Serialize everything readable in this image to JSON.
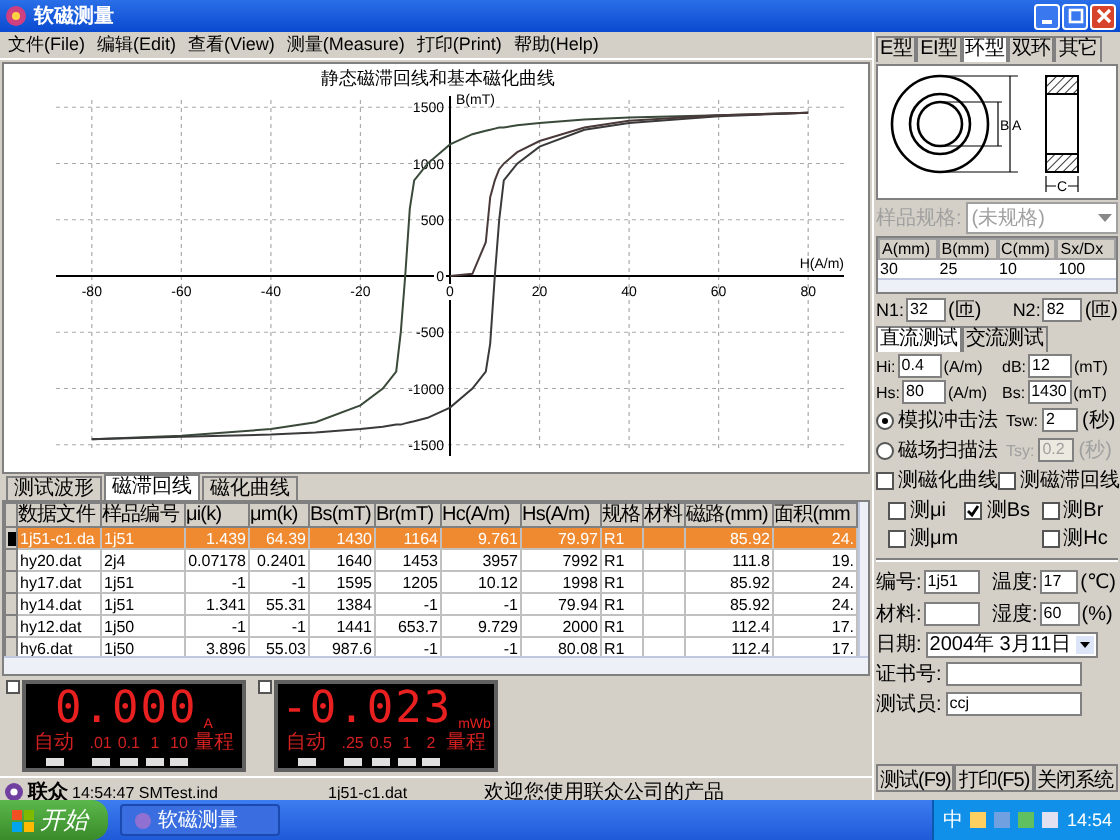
{
  "window": {
    "title": "软磁测量"
  },
  "menu": [
    "文件(File)",
    "编辑(Edit)",
    "查看(View)",
    "测量(Measure)",
    "打印(Print)",
    "帮助(Help)"
  ],
  "chart": {
    "chart_data": {
      "type": "line",
      "title": "静态磁滞回线和基本磁化曲线",
      "xlabel": "H(A/m)",
      "ylabel": "B(mT)",
      "x": [
        -80,
        -60,
        -40,
        -30,
        -20,
        -15,
        -12,
        -11,
        -10,
        -9,
        -8,
        -5,
        0,
        5,
        8,
        9,
        10,
        11,
        12,
        15,
        20,
        30,
        40,
        60,
        80
      ],
      "series": [
        {
          "values": [
            -1450,
            -1420,
            -1360,
            -1300,
            -1150,
            -1000,
            -850,
            -500,
            0,
            600,
            850,
            1000,
            1170,
            1260,
            1290,
            1300,
            1310,
            1320,
            1320,
            1340,
            1360,
            1390,
            1410,
            1430,
            1450
          ]
        },
        {
          "values": [
            -1450,
            -1430,
            -1410,
            -1390,
            -1360,
            -1340,
            -1320,
            -1320,
            -1310,
            -1300,
            -1290,
            -1260,
            -1170,
            -1000,
            -850,
            -600,
            0,
            500,
            850,
            1000,
            1150,
            1300,
            1360,
            1420,
            1450
          ]
        },
        {
          "values": [
            null,
            null,
            null,
            null,
            null,
            null,
            null,
            null,
            null,
            null,
            null,
            null,
            0,
            20,
            300,
            700,
            850,
            950,
            1000,
            1100,
            1200,
            1320,
            1380,
            1430,
            1450
          ]
        }
      ],
      "xticks": [
        -80,
        -60,
        -40,
        -20,
        0,
        20,
        40,
        60,
        80
      ],
      "yticks": [
        -1500,
        -1000,
        -500,
        0,
        500,
        1000,
        1500
      ],
      "xlim": [
        -88,
        88
      ],
      "ylim": [
        -1600,
        1600
      ],
      "grid": true
    }
  },
  "view_tabs": [
    {
      "label": "测试波形",
      "selected": false
    },
    {
      "label": "磁滞回线",
      "selected": true
    },
    {
      "label": "磁化曲线",
      "selected": false
    }
  ],
  "table": {
    "columns": [
      "数据文件",
      "样品编号",
      "μi(k)",
      "μm(k)",
      "Bs(mT)",
      "Br(mT)",
      "Hc(A/m)",
      "Hs(A/m)",
      "规格",
      "材料",
      "磁路(mm)",
      "面积(mm"
    ],
    "rows": [
      {
        "selected": true,
        "cells": [
          "1j51-c1.da",
          "1j51",
          "1.439",
          "64.39",
          "1430",
          "1164",
          "9.761",
          "79.97",
          "R1",
          "",
          "85.92",
          "24."
        ]
      },
      {
        "selected": false,
        "cells": [
          "hy20.dat",
          "2j4",
          "0.07178",
          "0.2401",
          "1640",
          "1453",
          "3957",
          "7992",
          "R1",
          "",
          "111.8",
          "19."
        ]
      },
      {
        "selected": false,
        "cells": [
          "hy17.dat",
          "1j51",
          "-1",
          "-1",
          "1595",
          "1205",
          "10.12",
          "1998",
          "R1",
          "",
          "85.92",
          "24."
        ]
      },
      {
        "selected": false,
        "cells": [
          "hy14.dat",
          "1j51",
          "1.341",
          "55.31",
          "1384",
          "-1",
          "-1",
          "79.94",
          "R1",
          "",
          "85.92",
          "24."
        ]
      },
      {
        "selected": false,
        "cells": [
          "hy12.dat",
          "1j50",
          "-1",
          "-1",
          "1441",
          "653.7",
          "9.729",
          "2000",
          "R1",
          "",
          "112.4",
          "17."
        ]
      },
      {
        "selected": false,
        "cells": [
          "hy6.dat",
          "1j50",
          "3.896",
          "55.03",
          "987.6",
          "-1",
          "-1",
          "80.08",
          "R1",
          "",
          "112.4",
          "17."
        ]
      }
    ]
  },
  "meters": [
    {
      "reading": "0.000",
      "unit": "A",
      "auto_label": "自动",
      "ranges": [
        ".01",
        "0.1",
        "1",
        "10"
      ],
      "range_label": "量程"
    },
    {
      "reading": "-0.023",
      "unit": "mWb",
      "auto_label": "自动",
      "ranges": [
        ".25",
        "0.5",
        "1",
        "2"
      ],
      "range_label": "量程"
    }
  ],
  "status_bar": {
    "logo": "联众",
    "time_file": "14:54:47 SMTest.ind",
    "data_file": "1j51-c1.dat",
    "message": "欢迎您使用联众公司的产品"
  },
  "core_tabs": [
    {
      "label": "E型",
      "selected": false
    },
    {
      "label": "EI型",
      "selected": false
    },
    {
      "label": "环型",
      "selected": true
    },
    {
      "label": "双环",
      "selected": false
    },
    {
      "label": "其它",
      "selected": false
    }
  ],
  "core_drawing": {
    "labels": [
      "B",
      "A",
      "C"
    ]
  },
  "sample_spec": {
    "label": "样品规格:",
    "value": "(未规格)",
    "disabled": true
  },
  "dimensions": {
    "columns": [
      "A(mm)",
      "B(mm)",
      "C(mm)",
      "Sx/Dx"
    ],
    "values": [
      "30",
      "25",
      "10",
      "100"
    ]
  },
  "turns": [
    {
      "label": "N1:",
      "value": "32",
      "unit": "(匝)"
    },
    {
      "label": "N2:",
      "value": "82",
      "unit": "(匝)"
    }
  ],
  "test_tabs": [
    {
      "label": "直流测试",
      "selected": true
    },
    {
      "label": "交流测试",
      "selected": false
    }
  ],
  "params": [
    {
      "label": "Hi:",
      "value": "0.4",
      "unit": "(A/m)"
    },
    {
      "label": "dB:",
      "value": "12",
      "unit": "(mT)"
    },
    {
      "label": "Hs:",
      "value": "80",
      "unit": "(A/m)"
    },
    {
      "label": "Bs:",
      "value": "1430",
      "unit": "(mT)"
    }
  ],
  "methods": [
    {
      "label": "模拟冲击法",
      "selected": true,
      "param": {
        "label": "Tsw:",
        "value": "2",
        "unit": "(秒)",
        "disabled": false
      }
    },
    {
      "label": "磁场扫描法",
      "selected": false,
      "param": {
        "label": "Tsy:",
        "value": "0.2",
        "unit": "(秒)",
        "disabled": true
      }
    }
  ],
  "curve_options": [
    {
      "label": "测磁化曲线",
      "checked": false
    },
    {
      "label": "测磁滞回线",
      "checked": false
    }
  ],
  "measure_options": [
    {
      "label": "测μi",
      "checked": false
    },
    {
      "label": "测Bs",
      "checked": true
    },
    {
      "label": "测Br",
      "checked": false
    },
    {
      "label": "测μm",
      "checked": false
    },
    {
      "label": "测Hc",
      "checked": false
    }
  ],
  "sample_grid": [
    {
      "label": "编号:",
      "value": "1j51"
    },
    {
      "label": "温度:",
      "value": "17",
      "unit": "(℃)"
    },
    {
      "label": "材料:"
    },
    {
      "label": "湿度:",
      "value": "60",
      "unit": "(%)"
    }
  ],
  "sample_rows": [
    {
      "label": "日期:",
      "value": "2004年 3月11日",
      "kind": "date"
    },
    {
      "label": "证书号:",
      "kind": "text"
    },
    {
      "label": "测试员:",
      "value": "ccj",
      "kind": "text"
    }
  ],
  "actions": [
    "测试(F9)",
    "打印(F5)",
    "关闭系统"
  ],
  "taskbar": {
    "start": "开始",
    "tasks": [
      "软磁测量"
    ],
    "ime": "中",
    "clock": "14:54"
  }
}
